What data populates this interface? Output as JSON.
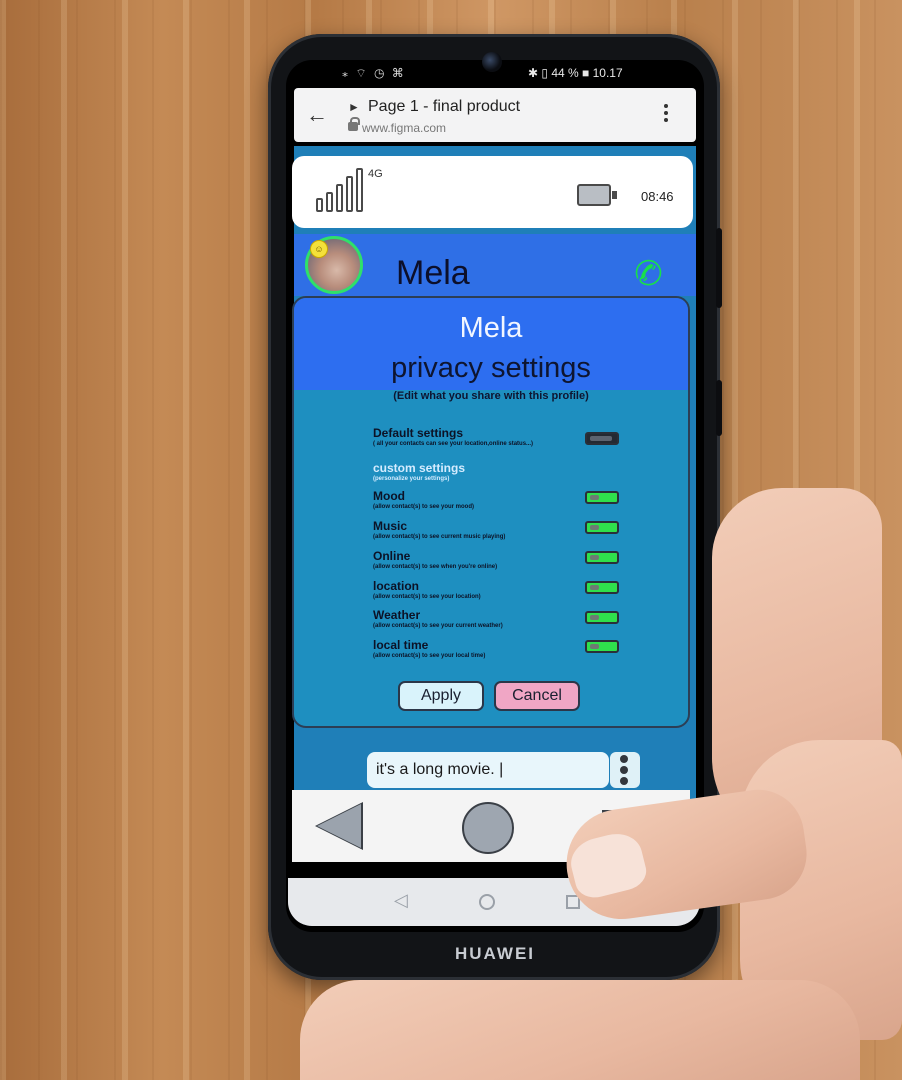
{
  "android_status": {
    "left_icons": "⁎ ⌔ ◷ ⌘",
    "right": "✱ ▯ 44 % ■ 10.17"
  },
  "browser": {
    "title": "Page 1 - final product",
    "url": "www.figma.com"
  },
  "prototype": {
    "status_bar": {
      "network": "4G",
      "time": "08:46"
    },
    "contact": {
      "name": "Mela",
      "mood_emoji": "☺"
    },
    "privacy_modal": {
      "title": "Mela",
      "subtitle": "privacy settings",
      "hint": "(Edit what you share with this profile)",
      "default": {
        "title": "Default settings",
        "desc": "( all your contacts can see your location,online status...)",
        "enabled": false
      },
      "custom": {
        "title": "custom settings",
        "desc": "(personalize your settings)"
      },
      "settings": [
        {
          "title": "Mood",
          "desc": "(allow contact(s) to see your mood)",
          "enabled": true
        },
        {
          "title": "Music",
          "desc": "(allow contact(s) to see current music playing)",
          "enabled": true
        },
        {
          "title": "Online",
          "desc": "(allow contact(s) to see when you're online)",
          "enabled": true
        },
        {
          "title": "location",
          "desc": "(allow contact(s) to see your location)",
          "enabled": true
        },
        {
          "title": "Weather",
          "desc": "(allow contact(s) to see your current weather)",
          "enabled": true
        },
        {
          "title": "local time",
          "desc": "(allow contact(s) to see your local time)",
          "enabled": true
        }
      ],
      "apply_label": "Apply",
      "cancel_label": "Cancel"
    },
    "message_input": {
      "value": "it's a long movie. |"
    }
  },
  "device_brand": "HUAWEI",
  "colors": {
    "header_blue": "#2d6ef0",
    "modal_teal": "#1e8fc0",
    "toggle_on": "#2fe04c",
    "apply_bg": "#d9f3fb",
    "cancel_bg": "#f0a6c5",
    "call_green": "#18e04a"
  }
}
